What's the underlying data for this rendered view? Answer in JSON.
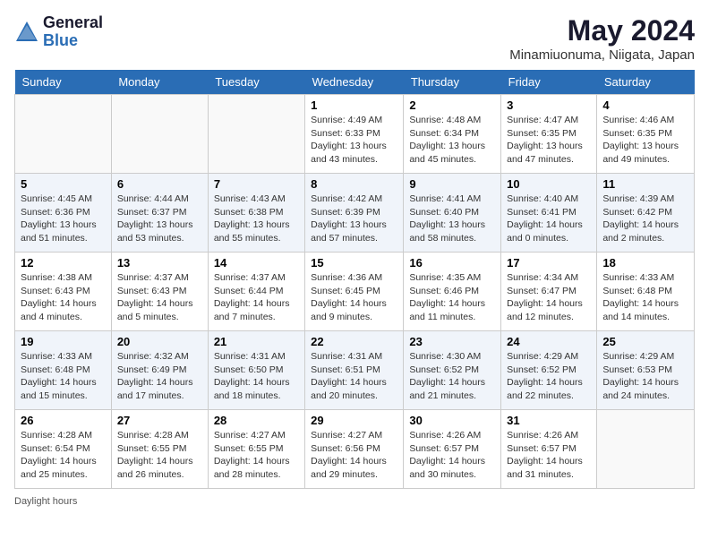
{
  "header": {
    "logo_general": "General",
    "logo_blue": "Blue",
    "month_year": "May 2024",
    "location": "Minamiuonuma, Niigata, Japan"
  },
  "days_of_week": [
    "Sunday",
    "Monday",
    "Tuesday",
    "Wednesday",
    "Thursday",
    "Friday",
    "Saturday"
  ],
  "weeks": [
    [
      {
        "day": "",
        "info": ""
      },
      {
        "day": "",
        "info": ""
      },
      {
        "day": "",
        "info": ""
      },
      {
        "day": "1",
        "info": "Sunrise: 4:49 AM\nSunset: 6:33 PM\nDaylight: 13 hours\nand 43 minutes."
      },
      {
        "day": "2",
        "info": "Sunrise: 4:48 AM\nSunset: 6:34 PM\nDaylight: 13 hours\nand 45 minutes."
      },
      {
        "day": "3",
        "info": "Sunrise: 4:47 AM\nSunset: 6:35 PM\nDaylight: 13 hours\nand 47 minutes."
      },
      {
        "day": "4",
        "info": "Sunrise: 4:46 AM\nSunset: 6:35 PM\nDaylight: 13 hours\nand 49 minutes."
      }
    ],
    [
      {
        "day": "5",
        "info": "Sunrise: 4:45 AM\nSunset: 6:36 PM\nDaylight: 13 hours\nand 51 minutes."
      },
      {
        "day": "6",
        "info": "Sunrise: 4:44 AM\nSunset: 6:37 PM\nDaylight: 13 hours\nand 53 minutes."
      },
      {
        "day": "7",
        "info": "Sunrise: 4:43 AM\nSunset: 6:38 PM\nDaylight: 13 hours\nand 55 minutes."
      },
      {
        "day": "8",
        "info": "Sunrise: 4:42 AM\nSunset: 6:39 PM\nDaylight: 13 hours\nand 57 minutes."
      },
      {
        "day": "9",
        "info": "Sunrise: 4:41 AM\nSunset: 6:40 PM\nDaylight: 13 hours\nand 58 minutes."
      },
      {
        "day": "10",
        "info": "Sunrise: 4:40 AM\nSunset: 6:41 PM\nDaylight: 14 hours\nand 0 minutes."
      },
      {
        "day": "11",
        "info": "Sunrise: 4:39 AM\nSunset: 6:42 PM\nDaylight: 14 hours\nand 2 minutes."
      }
    ],
    [
      {
        "day": "12",
        "info": "Sunrise: 4:38 AM\nSunset: 6:43 PM\nDaylight: 14 hours\nand 4 minutes."
      },
      {
        "day": "13",
        "info": "Sunrise: 4:37 AM\nSunset: 6:43 PM\nDaylight: 14 hours\nand 5 minutes."
      },
      {
        "day": "14",
        "info": "Sunrise: 4:37 AM\nSunset: 6:44 PM\nDaylight: 14 hours\nand 7 minutes."
      },
      {
        "day": "15",
        "info": "Sunrise: 4:36 AM\nSunset: 6:45 PM\nDaylight: 14 hours\nand 9 minutes."
      },
      {
        "day": "16",
        "info": "Sunrise: 4:35 AM\nSunset: 6:46 PM\nDaylight: 14 hours\nand 11 minutes."
      },
      {
        "day": "17",
        "info": "Sunrise: 4:34 AM\nSunset: 6:47 PM\nDaylight: 14 hours\nand 12 minutes."
      },
      {
        "day": "18",
        "info": "Sunrise: 4:33 AM\nSunset: 6:48 PM\nDaylight: 14 hours\nand 14 minutes."
      }
    ],
    [
      {
        "day": "19",
        "info": "Sunrise: 4:33 AM\nSunset: 6:48 PM\nDaylight: 14 hours\nand 15 minutes."
      },
      {
        "day": "20",
        "info": "Sunrise: 4:32 AM\nSunset: 6:49 PM\nDaylight: 14 hours\nand 17 minutes."
      },
      {
        "day": "21",
        "info": "Sunrise: 4:31 AM\nSunset: 6:50 PM\nDaylight: 14 hours\nand 18 minutes."
      },
      {
        "day": "22",
        "info": "Sunrise: 4:31 AM\nSunset: 6:51 PM\nDaylight: 14 hours\nand 20 minutes."
      },
      {
        "day": "23",
        "info": "Sunrise: 4:30 AM\nSunset: 6:52 PM\nDaylight: 14 hours\nand 21 minutes."
      },
      {
        "day": "24",
        "info": "Sunrise: 4:29 AM\nSunset: 6:52 PM\nDaylight: 14 hours\nand 22 minutes."
      },
      {
        "day": "25",
        "info": "Sunrise: 4:29 AM\nSunset: 6:53 PM\nDaylight: 14 hours\nand 24 minutes."
      }
    ],
    [
      {
        "day": "26",
        "info": "Sunrise: 4:28 AM\nSunset: 6:54 PM\nDaylight: 14 hours\nand 25 minutes."
      },
      {
        "day": "27",
        "info": "Sunrise: 4:28 AM\nSunset: 6:55 PM\nDaylight: 14 hours\nand 26 minutes."
      },
      {
        "day": "28",
        "info": "Sunrise: 4:27 AM\nSunset: 6:55 PM\nDaylight: 14 hours\nand 28 minutes."
      },
      {
        "day": "29",
        "info": "Sunrise: 4:27 AM\nSunset: 6:56 PM\nDaylight: 14 hours\nand 29 minutes."
      },
      {
        "day": "30",
        "info": "Sunrise: 4:26 AM\nSunset: 6:57 PM\nDaylight: 14 hours\nand 30 minutes."
      },
      {
        "day": "31",
        "info": "Sunrise: 4:26 AM\nSunset: 6:57 PM\nDaylight: 14 hours\nand 31 minutes."
      },
      {
        "day": "",
        "info": ""
      }
    ]
  ],
  "footer": {
    "note": "Daylight hours"
  }
}
